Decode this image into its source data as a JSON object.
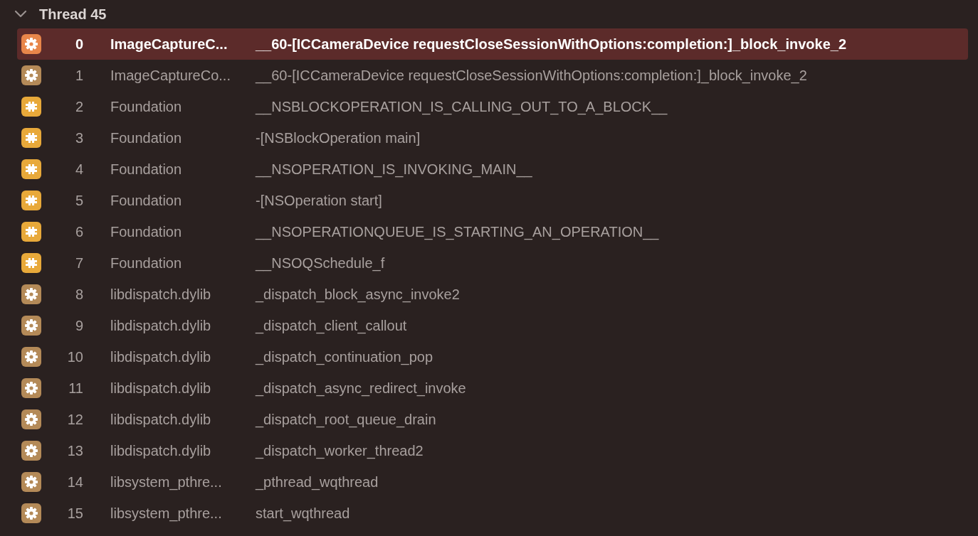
{
  "thread": {
    "title": "Thread 45",
    "expanded": true
  },
  "frames": [
    {
      "kind": "gear",
      "number": "0",
      "module": "ImageCaptureC...",
      "symbol": "__60-[ICCameraDevice requestCloseSessionWithOptions:completion:]_block_invoke_2",
      "selected": true
    },
    {
      "kind": "gear",
      "number": "1",
      "module": "ImageCaptureCo...",
      "symbol": "__60-[ICCameraDevice requestCloseSessionWithOptions:completion:]_block_invoke_2",
      "selected": false
    },
    {
      "kind": "plugin",
      "number": "2",
      "module": "Foundation",
      "symbol": "__NSBLOCKOPERATION_IS_CALLING_OUT_TO_A_BLOCK__",
      "selected": false
    },
    {
      "kind": "plugin",
      "number": "3",
      "module": "Foundation",
      "symbol": "-[NSBlockOperation main]",
      "selected": false
    },
    {
      "kind": "plugin",
      "number": "4",
      "module": "Foundation",
      "symbol": "__NSOPERATION_IS_INVOKING_MAIN__",
      "selected": false
    },
    {
      "kind": "plugin",
      "number": "5",
      "module": "Foundation",
      "symbol": "-[NSOperation start]",
      "selected": false
    },
    {
      "kind": "plugin",
      "number": "6",
      "module": "Foundation",
      "symbol": "__NSOPERATIONQUEUE_IS_STARTING_AN_OPERATION__",
      "selected": false
    },
    {
      "kind": "plugin",
      "number": "7",
      "module": "Foundation",
      "symbol": "__NSOQSchedule_f",
      "selected": false
    },
    {
      "kind": "gear",
      "number": "8",
      "module": "libdispatch.dylib",
      "symbol": "_dispatch_block_async_invoke2",
      "selected": false
    },
    {
      "kind": "gear",
      "number": "9",
      "module": "libdispatch.dylib",
      "symbol": "_dispatch_client_callout",
      "selected": false
    },
    {
      "kind": "gear",
      "number": "10",
      "module": "libdispatch.dylib",
      "symbol": "_dispatch_continuation_pop",
      "selected": false
    },
    {
      "kind": "gear",
      "number": "11",
      "module": "libdispatch.dylib",
      "symbol": "_dispatch_async_redirect_invoke",
      "selected": false
    },
    {
      "kind": "gear",
      "number": "12",
      "module": "libdispatch.dylib",
      "symbol": "_dispatch_root_queue_drain",
      "selected": false
    },
    {
      "kind": "gear",
      "number": "13",
      "module": "libdispatch.dylib",
      "symbol": "_dispatch_worker_thread2",
      "selected": false
    },
    {
      "kind": "gear",
      "number": "14",
      "module": "libsystem_pthre...",
      "symbol": "_pthread_wqthread",
      "selected": false
    },
    {
      "kind": "gear",
      "number": "15",
      "module": "libsystem_pthre...",
      "symbol": "start_wqthread",
      "selected": false
    }
  ]
}
